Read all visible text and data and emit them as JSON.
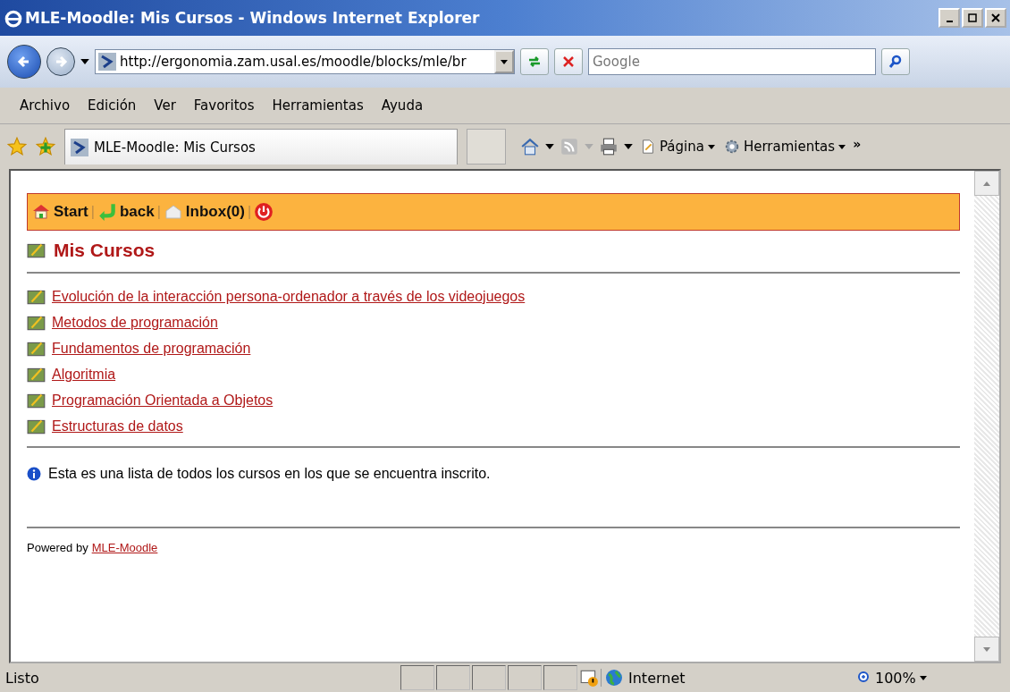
{
  "window": {
    "title": "MLE-Moodle: Mis Cursos - Windows Internet Explorer"
  },
  "address": {
    "url": "http://ergonomia.zam.usal.es/moodle/blocks/mle/br"
  },
  "search": {
    "placeholder": "Google"
  },
  "menu": [
    "Archivo",
    "Edición",
    "Ver",
    "Favoritos",
    "Herramientas",
    "Ayuda"
  ],
  "tab": {
    "title": "MLE-Moodle: Mis Cursos"
  },
  "command_bar": {
    "page": "Página",
    "tools": "Herramientas",
    "more": "»"
  },
  "nav": [
    {
      "kind": "home",
      "label": "Start"
    },
    {
      "kind": "sep",
      "label": "|"
    },
    {
      "kind": "back",
      "label": "back"
    },
    {
      "kind": "sep",
      "label": "|"
    },
    {
      "kind": "mail",
      "label": "Inbox(0)"
    },
    {
      "kind": "sep",
      "label": "|"
    },
    {
      "kind": "power"
    }
  ],
  "heading": "Mis Cursos",
  "courses": [
    "Evolución de la interacción persona-ordenador a través de los videojuegos",
    "Metodos de programación",
    "Fundamentos de programación",
    "Algoritmia",
    "Programación Orientada a Objetos",
    "Estructuras de datos"
  ],
  "info": "Esta es una lista de todos los cursos en los que se encuentra inscrito.",
  "footer": {
    "text": "Powered by",
    "link": "MLE-Moodle"
  },
  "status_bar": {
    "text": "Listo",
    "zone": "Internet",
    "zoom": "100%"
  }
}
